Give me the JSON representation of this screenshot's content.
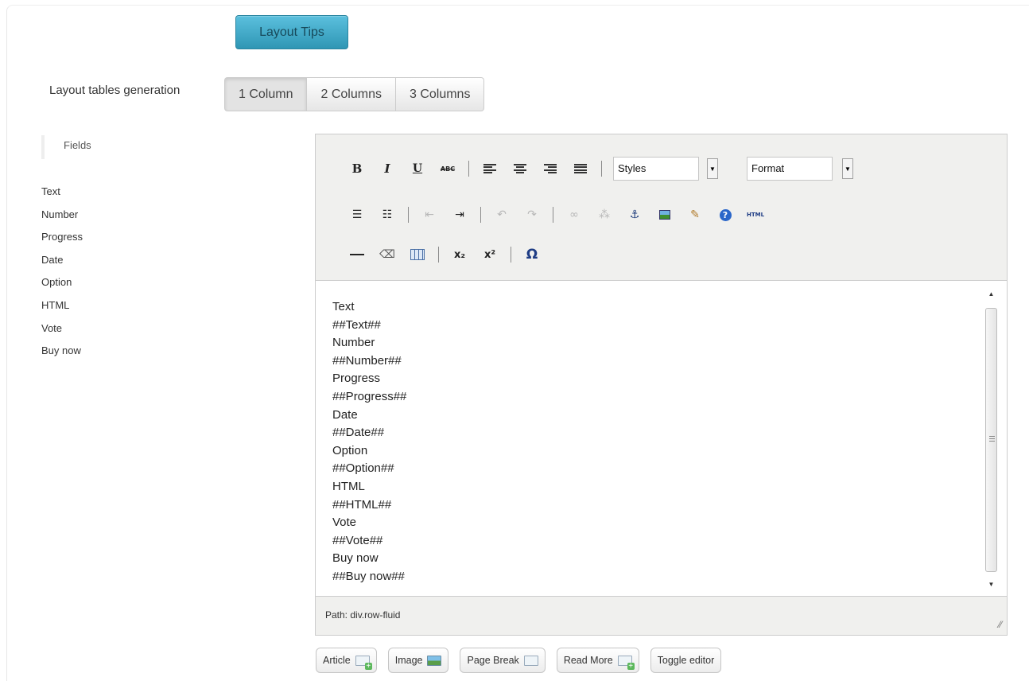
{
  "layout_tips_label": "Layout Tips",
  "layout_generation": {
    "label": "Layout tables generation",
    "options": [
      "1 Column",
      "2 Columns",
      "3 Columns"
    ],
    "selected": "1 Column"
  },
  "fields": {
    "heading": "Fields",
    "items": [
      "Text",
      "Number",
      "Progress",
      "Date",
      "Option",
      "HTML",
      "Vote",
      "Buy now"
    ]
  },
  "editor": {
    "toolbar": {
      "bold": "B",
      "italic": "I",
      "underline": "U",
      "strikethrough": "ABC",
      "styles_select": "Styles",
      "format_select": "Format",
      "html_button": "HTML",
      "subscript": "x₂",
      "superscript": "x²",
      "special_char": "Ω"
    },
    "content_lines": [
      "Text",
      "##Text##",
      "Number",
      "##Number##",
      "Progress",
      "##Progress##",
      "Date",
      "##Date##",
      "Option",
      "##Option##",
      "HTML",
      "##HTML##",
      "Vote",
      "##Vote##",
      "Buy now",
      "##Buy now##"
    ],
    "path": "Path: div.row-fluid"
  },
  "bottom_buttons": [
    "Article",
    "Image",
    "Page Break",
    "Read More",
    "Toggle editor"
  ]
}
